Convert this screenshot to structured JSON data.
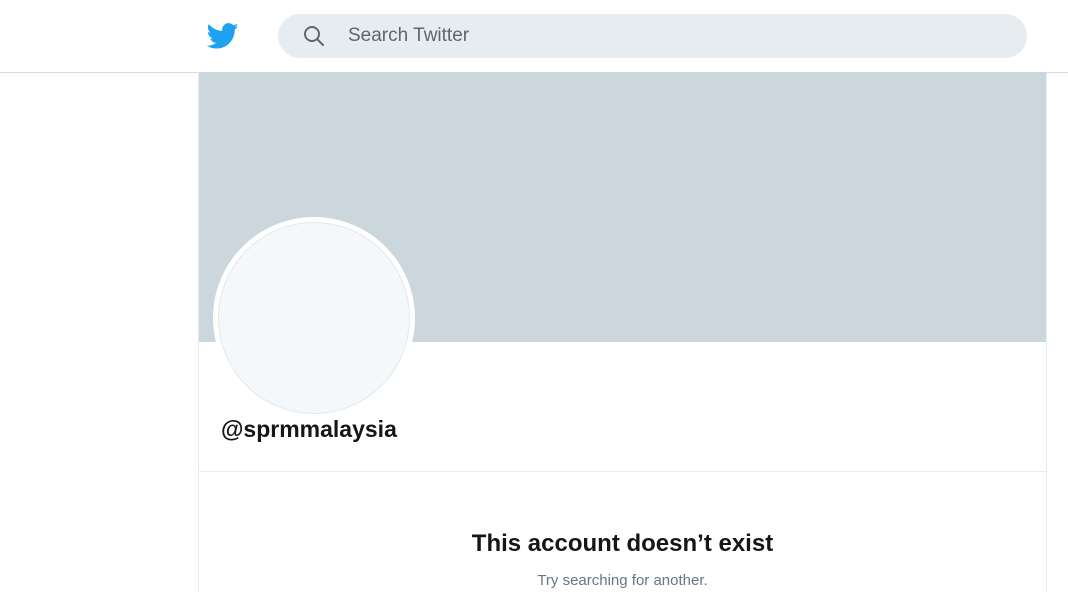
{
  "header": {
    "logo_icon": "twitter-bird-icon",
    "search": {
      "icon": "search-icon",
      "placeholder": "Search Twitter",
      "value": ""
    }
  },
  "profile": {
    "handle": "@sprmmalaysia"
  },
  "message": {
    "title": "This account doesn’t exist",
    "subtitle": "Try searching for another."
  },
  "colors": {
    "brand": "#1da1f2",
    "banner": "#ccd6dd",
    "search_bg": "#e6ecf0",
    "text": "#14171a"
  }
}
